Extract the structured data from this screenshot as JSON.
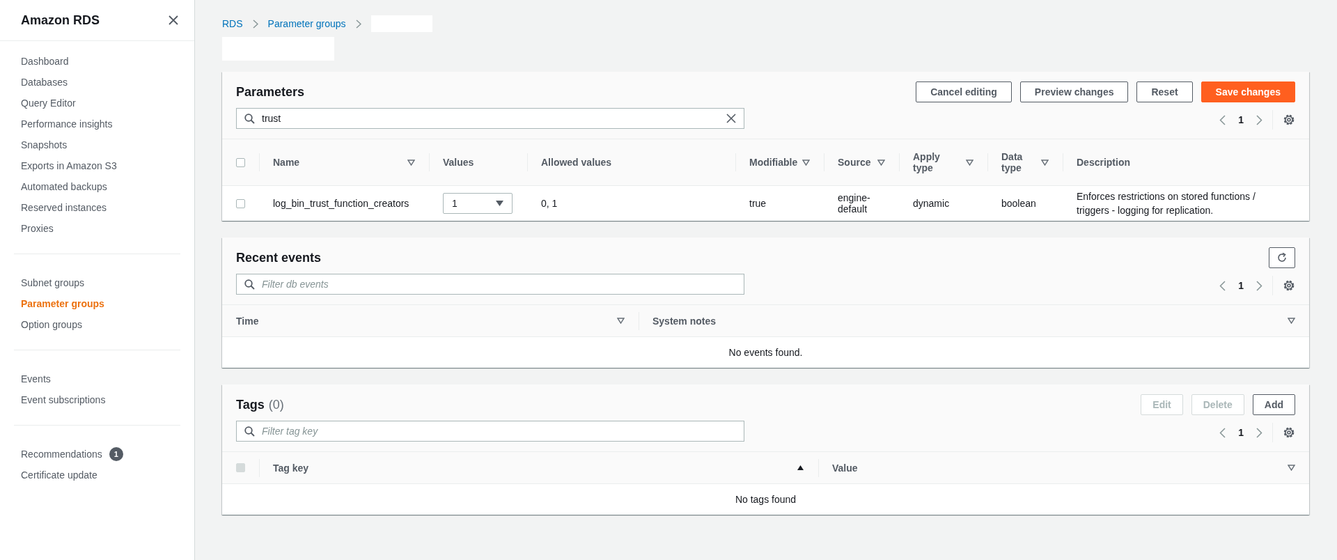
{
  "sidebar": {
    "title": "Amazon RDS",
    "sections": [
      [
        {
          "label": "Dashboard",
          "selected": false
        },
        {
          "label": "Databases",
          "selected": false
        },
        {
          "label": "Query Editor",
          "selected": false
        },
        {
          "label": "Performance insights",
          "selected": false
        },
        {
          "label": "Snapshots",
          "selected": false
        },
        {
          "label": "Exports in Amazon S3",
          "selected": false
        },
        {
          "label": "Automated backups",
          "selected": false
        },
        {
          "label": "Reserved instances",
          "selected": false
        },
        {
          "label": "Proxies",
          "selected": false
        }
      ],
      [
        {
          "label": "Subnet groups",
          "selected": false
        },
        {
          "label": "Parameter groups",
          "selected": true
        },
        {
          "label": "Option groups",
          "selected": false
        }
      ],
      [
        {
          "label": "Events",
          "selected": false
        },
        {
          "label": "Event subscriptions",
          "selected": false
        }
      ],
      [
        {
          "label": "Recommendations",
          "selected": false,
          "badge": "1"
        },
        {
          "label": "Certificate update",
          "selected": false
        }
      ]
    ]
  },
  "breadcrumb": [
    {
      "kind": "link",
      "label": "RDS"
    },
    {
      "kind": "link",
      "label": "Parameter groups"
    },
    {
      "kind": "redacted"
    }
  ],
  "page_title": {
    "redacted": true
  },
  "parameters": {
    "title": "Parameters",
    "buttons": [
      {
        "label": "Cancel editing",
        "kind": "normal",
        "disabled": false
      },
      {
        "label": "Preview changes",
        "kind": "normal",
        "disabled": false
      },
      {
        "label": "Reset",
        "kind": "normal",
        "disabled": false
      },
      {
        "label": "Save changes",
        "kind": "primary",
        "disabled": false
      }
    ],
    "search": {
      "value": "trust"
    },
    "page": "1",
    "select_all": {
      "checked": false,
      "disabled": false
    },
    "columns": [
      {
        "label": "Name",
        "sortable": true
      },
      {
        "label": "Values",
        "sortable": false
      },
      {
        "label": "Allowed values",
        "sortable": false
      },
      {
        "label": "Modifiable",
        "sortable": true
      },
      {
        "label": "Source",
        "sortable": true
      },
      {
        "label": "Apply type",
        "sortable": true
      },
      {
        "label": "Data type",
        "sortable": true
      },
      {
        "label": "Description",
        "sortable": false
      }
    ],
    "rows": [
      {
        "checked": false,
        "name": "log_bin_trust_function_creators",
        "value": "1",
        "allowed_values": "0, 1",
        "modifiable": "true",
        "source": "engine-default",
        "apply_type": "dynamic",
        "data_type": "boolean",
        "description": "Enforces restrictions on stored functions / triggers - logging for replication."
      }
    ]
  },
  "events": {
    "title": "Recent events",
    "search": {
      "placeholder": "Filter db events"
    },
    "page": "1",
    "columns": [
      {
        "label": "Time",
        "sortable": true
      },
      {
        "label": "System notes",
        "sortable": true
      }
    ],
    "empty": "No events found."
  },
  "tags": {
    "title": "Tags",
    "count": "(0)",
    "buttons": [
      {
        "label": "Edit",
        "disabled": true
      },
      {
        "label": "Delete",
        "disabled": true
      },
      {
        "label": "Add",
        "disabled": false
      }
    ],
    "search": {
      "placeholder": "Filter tag key"
    },
    "page": "1",
    "select_all": {
      "checked": false,
      "disabled": true
    },
    "columns": [
      {
        "label": "Tag key",
        "sorted": true
      },
      {
        "label": "Value",
        "sorted": false
      }
    ],
    "empty": "No tags found"
  }
}
